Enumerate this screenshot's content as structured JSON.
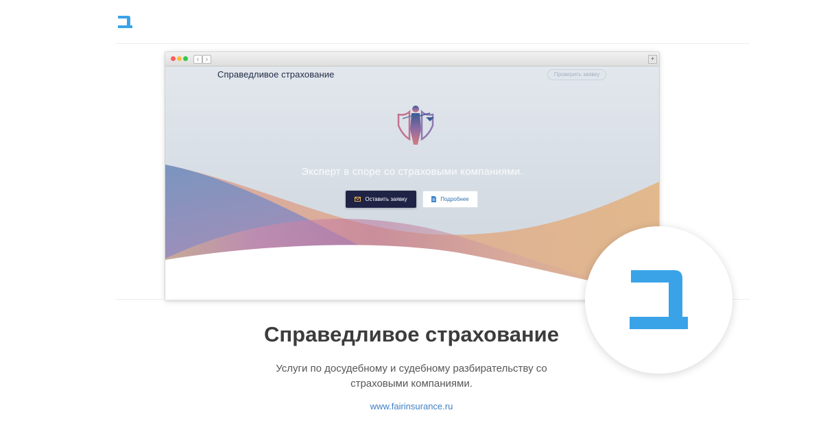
{
  "brand": {
    "logo_icon": "bet-letter-logo-icon",
    "accent_color": "#3aa3e8"
  },
  "browser": {
    "chrome": {
      "back_symbol": "‹",
      "forward_symbol": "›",
      "new_tab_symbol": "+"
    },
    "site": {
      "title": "Справедливое страхование",
      "check_button": "Проверить заявку",
      "hero_text": "Эксперт в споре со страховыми компаниями.",
      "emblem_icon": "lady-justice-shield-icon",
      "apply_button": "Оставить заявку",
      "apply_icon": "envelope-icon",
      "more_button": "Подробнее",
      "more_icon": "document-icon",
      "button_dark_color": "#1f2446"
    }
  },
  "card": {
    "title": "Справедливое страхование",
    "description": "Услуги по досудебному и судебному разбирательству со страховыми компаниями.",
    "url": "www.fairinsurance.ru"
  }
}
